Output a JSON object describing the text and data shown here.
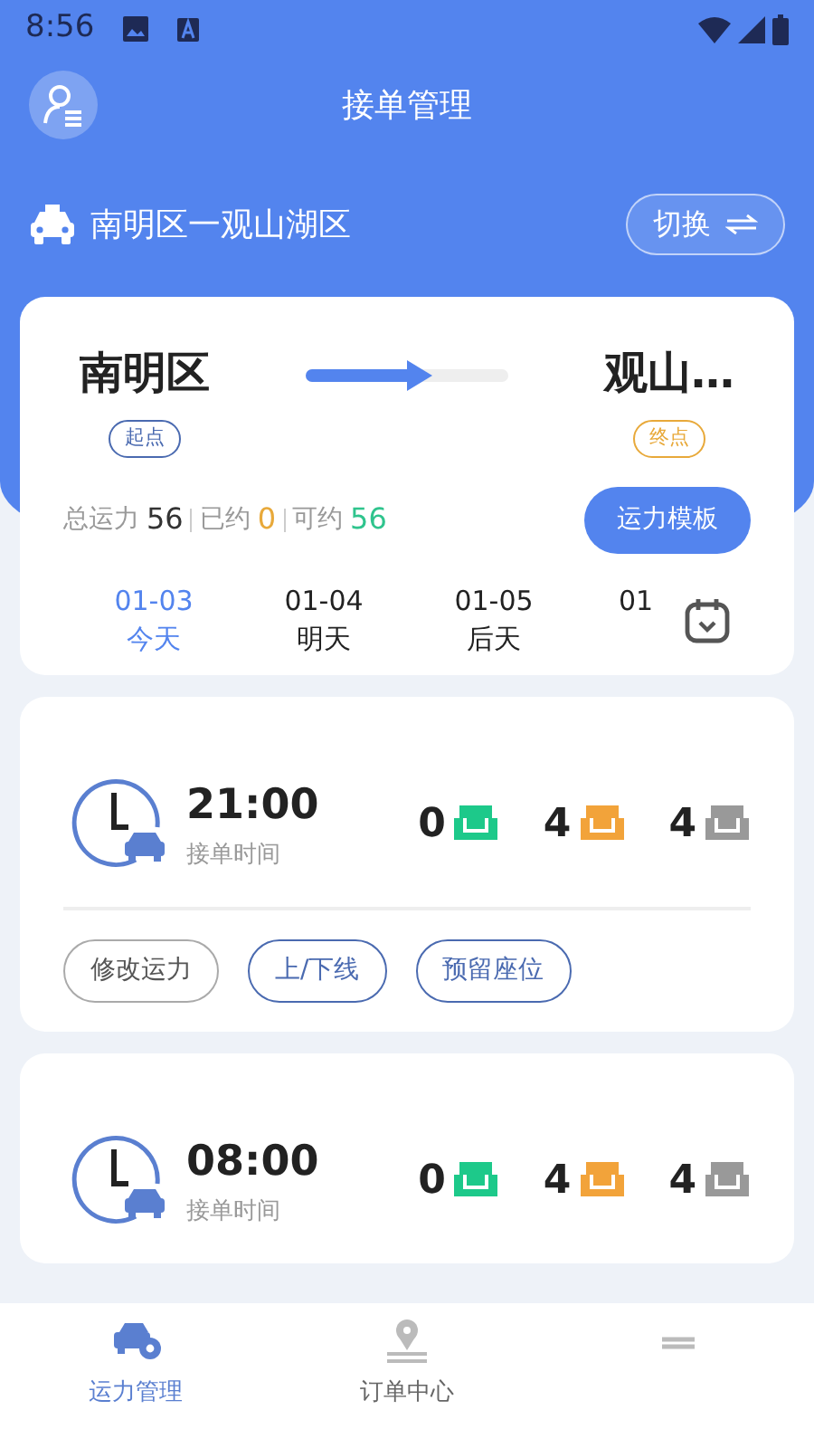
{
  "status_bar": {
    "time": "8:56"
  },
  "header": {
    "title": "接单管理",
    "route": "南明区一观山湖区",
    "switch_button": "切换"
  },
  "route_card": {
    "origin": "南明区",
    "origin_tag": "起点",
    "destination": "观山…",
    "destination_tag": "终点",
    "progress": {
      "level": 0.55
    },
    "stats": [
      {
        "label": "总运力",
        "value": "56",
        "color": "#333333"
      },
      {
        "label": "已约",
        "value": "0",
        "color": "#e8a93a"
      },
      {
        "label": "可约",
        "value": "56",
        "color": "#2fc48d"
      }
    ],
    "template_button": "运力模板",
    "dates": [
      {
        "date": "01-03",
        "day": "今天",
        "selected": true
      },
      {
        "date": "01-04",
        "day": "明天",
        "selected": false
      },
      {
        "date": "01-05",
        "day": "后天",
        "selected": false
      },
      {
        "date": "01",
        "selected": false
      }
    ]
  },
  "slots": [
    {
      "time": "21:00",
      "caption": "接单时间",
      "seats": [
        {
          "count": "0",
          "color": "#1dc98a"
        },
        {
          "count": "4",
          "color": "#f2a33a"
        },
        {
          "count": "4",
          "color": "#999999"
        }
      ],
      "actions": [
        {
          "label": "修改运力",
          "kind": "plain"
        },
        {
          "label": "上/下线",
          "kind": "primary"
        },
        {
          "label": "预留座位",
          "kind": "primary"
        }
      ]
    },
    {
      "time": "08:00",
      "caption": "接单时间",
      "seats": [
        {
          "count": "0",
          "color": "#1dc98a"
        },
        {
          "count": "4",
          "color": "#f2a33a"
        },
        {
          "count": "4",
          "color": "#999999"
        }
      ]
    }
  ],
  "bottom_nav": [
    {
      "label": "运力管理",
      "kind": "car",
      "selected": true
    },
    {
      "label": "订单中心",
      "kind": "pin",
      "selected": false
    },
    {
      "kind": "list",
      "selected": false
    }
  ]
}
